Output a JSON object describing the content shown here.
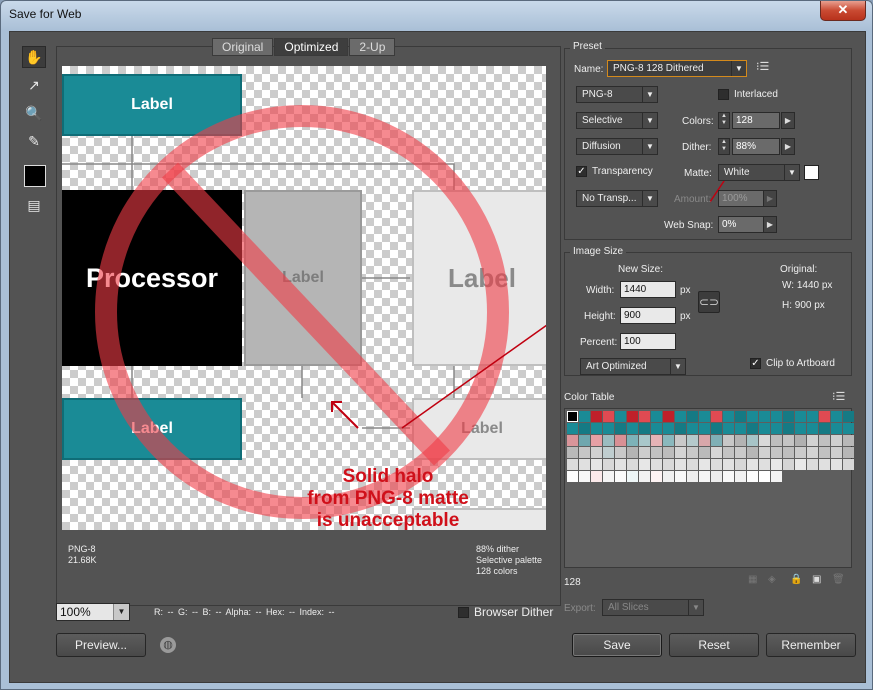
{
  "window": {
    "title": "Save for Web",
    "close_label": "✕"
  },
  "tools": [
    {
      "name": "hand-tool",
      "glyph": "✋"
    },
    {
      "name": "slice-select-tool",
      "glyph": "↗"
    },
    {
      "name": "zoom-tool",
      "glyph": "🔍"
    },
    {
      "name": "eyedropper-tool",
      "glyph": "✎"
    }
  ],
  "tabs": [
    "Original",
    "Optimized",
    "2-Up"
  ],
  "preview": {
    "boxes": {
      "top_left": "Label",
      "processor": "Processor",
      "gray_middle": "Label",
      "gray_right": "Label",
      "bottom_left": "Label",
      "bottom_right": "Label"
    },
    "callout": [
      "Solid halo",
      "from PNG-8 matte",
      "is unacceptable"
    ],
    "info_left": [
      "PNG-8",
      "21.68K"
    ],
    "info_right": [
      "88% dither",
      "Selective palette",
      "128 colors"
    ]
  },
  "bottom": {
    "zoom": "100%",
    "readout": "R: --   G: --   B: --   Alpha: --   Hex: --   Index: --",
    "browser_dither_label": "Browser Dither",
    "browser_dither_checked": false,
    "preview_button": "Preview...",
    "save_button": "Save",
    "reset_button": "Reset",
    "remember_button": "Remember"
  },
  "preset": {
    "group_label": "Preset",
    "name_label": "Name:",
    "name_value": "PNG-8 128 Dithered",
    "format": "PNG-8",
    "interlaced_label": "Interlaced",
    "interlaced_checked": false,
    "reduction": "Selective",
    "colors_label": "Colors:",
    "colors_value": "128",
    "dither_algo": "Diffusion",
    "dither_label": "Dither:",
    "dither_value": "88%",
    "transparency_label": "Transparency",
    "transparency_checked": true,
    "matte_label": "Matte:",
    "matte_value": "White",
    "trans_dither": "No Transp...",
    "amount_label": "Amount:",
    "amount_value": "100%",
    "websnap_label": "Web Snap:",
    "websnap_value": "0%"
  },
  "image_size": {
    "group_label": "Image Size",
    "new_size_label": "New Size:",
    "width_label": "Width:",
    "width_value": "1440",
    "height_label": "Height:",
    "height_value": "900",
    "percent_label": "Percent:",
    "percent_value": "100",
    "px": "px",
    "original_label": "Original:",
    "original_w": "W:   1440 px",
    "original_h": "H:    900 px",
    "quality": "Art Optimized",
    "clip_label": "Clip to Artboard",
    "clip_checked": true
  },
  "color_table": {
    "label": "Color Table",
    "count": "128",
    "colors": [
      "#000000",
      "#1a8b96",
      "#c0202a",
      "#e04a52",
      "#1a8b96",
      "#c0202a",
      "#e04a52",
      "#1a8b96",
      "#c0202a",
      "#1a8b96",
      "#157a84",
      "#1a8b96",
      "#e04a52",
      "#1a8b96",
      "#157a84",
      "#1a8b96",
      "#1a8b96",
      "#1a8b96",
      "#157a84",
      "#1a8b96",
      "#1a8b96",
      "#e04a52",
      "#1a8b96",
      "#157a84",
      "#1a8b96",
      "#157a84",
      "#1a8b96",
      "#1a8b96",
      "#157a84",
      "#1a8b96",
      "#157a84",
      "#1a8b96",
      "#1a8b96",
      "#157a84",
      "#1a8b96",
      "#1a8b96",
      "#157a84",
      "#1a8b96",
      "#1a8b96",
      "#157a84",
      "#1a8b96",
      "#1a8b96",
      "#157a84",
      "#1a8b96",
      "#1a8b96",
      "#157a84",
      "#1a8b96",
      "#1a8b96",
      "#d9959a",
      "#6fa7ae",
      "#e6a0a5",
      "#9bbcc0",
      "#d89095",
      "#7db2b8",
      "#a9c7ca",
      "#e5b3b6",
      "#8ab8bd",
      "#c9c9c9",
      "#b5c9cb",
      "#d8a7aa",
      "#7fb0b6",
      "#c7c7c7",
      "#b3b3b3",
      "#a7c4c7",
      "#d9d9d9",
      "#bdbdbd",
      "#c4c4c4",
      "#b0b0b0",
      "#d2d2d2",
      "#c0c0c0",
      "#cfcfcf",
      "#b8b8b8",
      "#b9b9b9",
      "#c6c6c6",
      "#d0d0d0",
      "#bfcdcf",
      "#c9c9c9",
      "#b4b4b4",
      "#cdcdcd",
      "#c2c2c2",
      "#bcbcbc",
      "#d4d4d4",
      "#c8c8c8",
      "#bababa",
      "#d6d6d6",
      "#c3c3c3",
      "#cacaca",
      "#b7b7b7",
      "#d1d1d1",
      "#c5c5c5",
      "#bebebe",
      "#cbcbcb",
      "#d3d3d3",
      "#c1c1c1",
      "#cecece",
      "#b6b6b6",
      "#dcdcdc",
      "#e0e0e0",
      "#e5e5e5",
      "#d8d8d8",
      "#e2e2e2",
      "#dadada",
      "#e7e7e7",
      "#dedede",
      "#d9d9d9",
      "#e3e3e3",
      "#dbdbdb",
      "#e6e6e6",
      "#dddddd",
      "#e1e1e1",
      "#d7d7d7",
      "#e4e4e4",
      "#dfdfdf",
      "#e8e8e8",
      "#d5d5d5",
      "#e9e9e9",
      "#dcdcdc",
      "#e0e0e0",
      "#e3e3e3",
      "#d8d8d8",
      "#ffffff",
      "#f7f7f7",
      "#fbe9ea",
      "#f4f4f4",
      "#fafafa",
      "#eef6f7",
      "#f2f2f2",
      "#fdf3f3",
      "#f0f0f0",
      "#f8f8f8",
      "#eeeeee",
      "#f5f5f5",
      "#ececec",
      "#f9f9f9",
      "#f1f1f1",
      "#fcfcfc",
      "#ffffff",
      "#f3f3f3"
    ]
  },
  "export": {
    "label": "Export:",
    "value": "All Slices"
  }
}
